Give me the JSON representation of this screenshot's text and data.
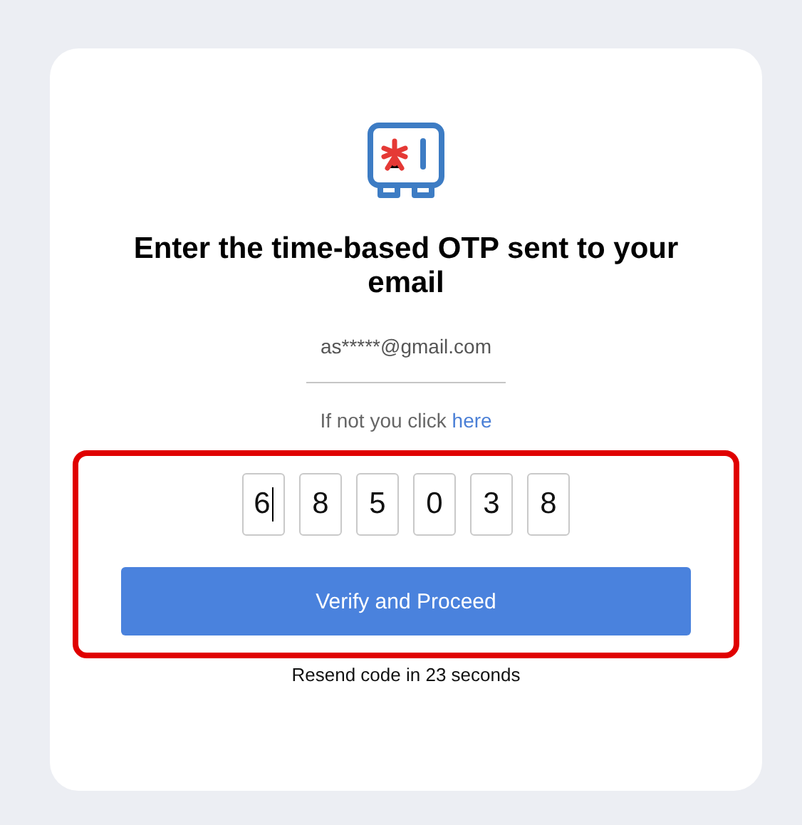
{
  "title": "Enter the time-based OTP sent to your email",
  "email": "as*****@gmail.com",
  "not_you": {
    "text": "If not you click",
    "link": "here"
  },
  "highlight_box": true,
  "otp_digits": [
    {
      "value": "6",
      "focused": true
    },
    {
      "value": "8",
      "focused": false
    },
    {
      "value": "5",
      "focused": false
    },
    {
      "value": "0",
      "focused": false
    },
    {
      "value": "3",
      "focused": false
    },
    {
      "value": "8",
      "focused": false
    }
  ],
  "verify_button": "Verify and Proceed",
  "resend": "Resend code in 23 seconds"
}
